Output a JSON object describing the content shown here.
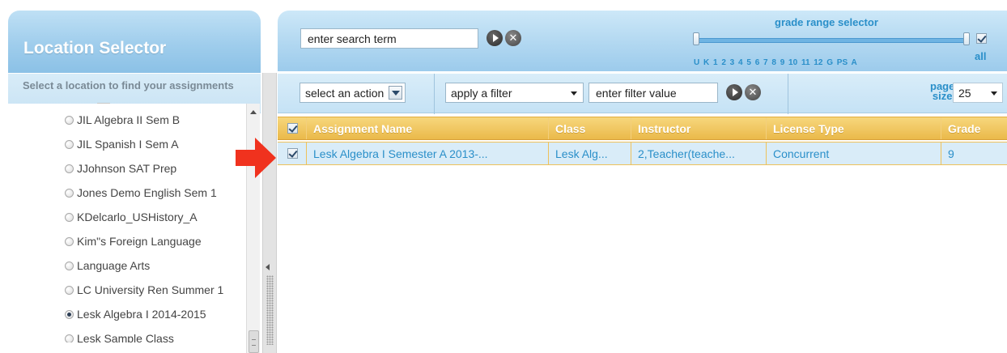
{
  "location_selector": {
    "title": "Location Selector",
    "subtitle": "Select a location to find your assignments",
    "items": [
      {
        "label": "JIL Algebra II Sem B",
        "selected": false
      },
      {
        "label": "JIL Spanish I Sem A",
        "selected": false
      },
      {
        "label": "JJohnson SAT Prep",
        "selected": false
      },
      {
        "label": "Jones Demo English Sem 1",
        "selected": false
      },
      {
        "label": "KDelcarlo_USHistory_A",
        "selected": false
      },
      {
        "label": "Kim\"s Foreign Language",
        "selected": false
      },
      {
        "label": "Language Arts",
        "selected": false
      },
      {
        "label": "LC University Ren Summer 1",
        "selected": false
      },
      {
        "label": "Lesk Algebra I 2014-2015",
        "selected": true
      },
      {
        "label": "Lesk Sample Class",
        "selected": false
      }
    ]
  },
  "search": {
    "value": "enter search term"
  },
  "grade_range": {
    "title": "grade range selector",
    "labels": "U K 1 2 3 4 5 6 7 8 9 10 11 12 G PS A",
    "all_label": "all",
    "all_checked": true
  },
  "toolbar": {
    "action_select": "select an action",
    "filter_select": "apply a filter",
    "filter_value": "enter filter value",
    "page_size_label_line1": "page",
    "page_size_label_line2": "size",
    "page_size_value": "25"
  },
  "grid": {
    "columns": [
      "Assignment Name",
      "Class",
      "Instructor",
      "License Type",
      "Grade"
    ],
    "header_checked": true,
    "rows": [
      {
        "checked": true,
        "cells": [
          "Lesk Algebra I Semester A 2013-...",
          "Lesk Alg...",
          "2,Teacher(teache...",
          "Concurrent",
          "9"
        ]
      }
    ]
  },
  "colors": {
    "header_blue": "#9fcdec",
    "accent_blue": "#2a8fc9",
    "grid_header_gold": "#eab94a",
    "row_highlight": "#d9ecf8",
    "arrow_red": "#f0321e"
  }
}
